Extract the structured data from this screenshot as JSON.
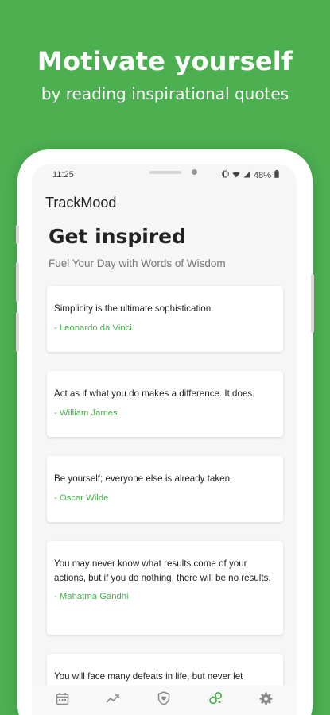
{
  "promo": {
    "title": "Motivate yourself",
    "subtitle": "by reading inspirational quotes"
  },
  "status_bar": {
    "time": "11:25",
    "battery": "48%"
  },
  "app_bar": {
    "title": "TrackMood"
  },
  "page": {
    "title": "Get inspired",
    "subtitle": "Fuel Your Day with Words of Wisdom"
  },
  "quotes": [
    {
      "text": "Simplicity is the ultimate sophistication.",
      "author": "- Leonardo da Vinci"
    },
    {
      "text": "Act as if what you do makes a difference. It does.",
      "author": "- William James"
    },
    {
      "text": "Be yourself; everyone else is already taken.",
      "author": "- Oscar Wilde"
    },
    {
      "text": "You may never know what results come of your actions, but if you do nothing, there will be no results.",
      "author": "- Mahatma Gandhi"
    },
    {
      "text": "You will face many defeats in life, but never let",
      "author": ""
    }
  ],
  "bottom_nav": [
    {
      "icon": "calendar-icon",
      "active": false
    },
    {
      "icon": "trend-icon",
      "active": false
    },
    {
      "icon": "shield-heart-icon",
      "active": false
    },
    {
      "icon": "quotes-icon",
      "active": true
    },
    {
      "icon": "gear-icon",
      "active": false
    }
  ],
  "colors": {
    "brand": "#4caf50",
    "inactive_icon": "#8a8a8a"
  }
}
